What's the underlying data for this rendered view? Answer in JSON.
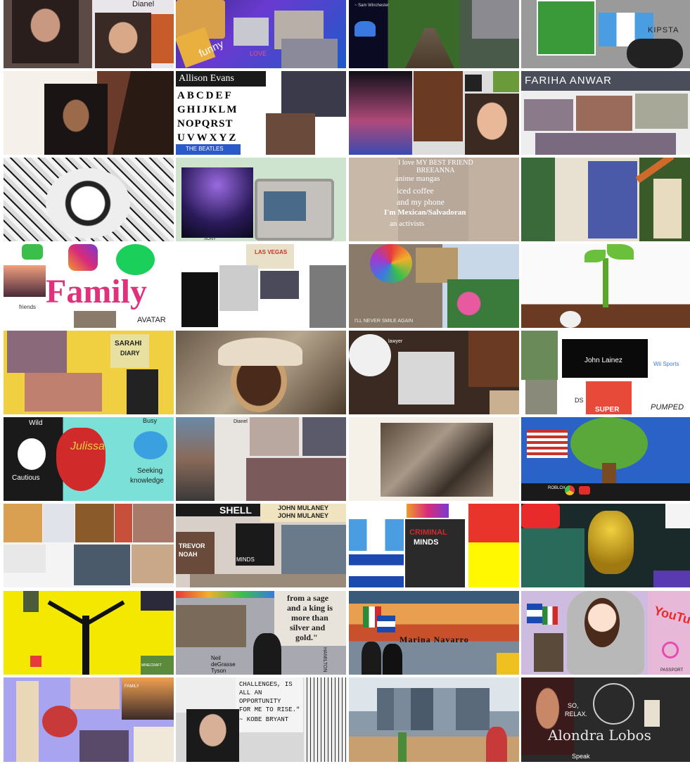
{
  "tiles": [
    {
      "id": "r0c0",
      "texts": {
        "name": "Dianel"
      }
    },
    {
      "id": "r0c1",
      "texts": {
        "a": "funny",
        "b": "LOVE"
      }
    },
    {
      "id": "r0c2",
      "texts": {
        "a": "~ Sam Winchester"
      }
    },
    {
      "id": "r0c3",
      "texts": {
        "a": "KIPSTA"
      }
    },
    {
      "id": "r1c0",
      "texts": {}
    },
    {
      "id": "r1c1",
      "texts": {
        "name": "Allison Evans",
        "alpha1": "ABCDEF",
        "alpha2": "GHIJKLM",
        "alpha3": "NOPQRST",
        "alpha4": "UVWXYZ",
        "band": "THE BEATLES"
      }
    },
    {
      "id": "r1c2",
      "texts": {}
    },
    {
      "id": "r1c3",
      "texts": {
        "name": "FARIHA ANWAR"
      }
    },
    {
      "id": "r2c0",
      "texts": {}
    },
    {
      "id": "r2c1",
      "texts": {
        "a": "SONY"
      }
    },
    {
      "id": "r2c2",
      "texts": {
        "l1": "I love MY BEST FRIEND",
        "l2": "BREEANNA",
        "l3": "anime mangas",
        "l4": "iced coffee",
        "l5": "and my phone",
        "l6": "I'm Mexican/Salvadoran",
        "l7": "an activists"
      }
    },
    {
      "id": "r2c3",
      "texts": {}
    },
    {
      "id": "r3c0",
      "texts": {
        "family": "Family",
        "friends": "friends",
        "avatar": "AVATAR"
      }
    },
    {
      "id": "r3c1",
      "texts": {
        "a": "LAS VEGAS"
      }
    },
    {
      "id": "r3c2",
      "texts": {
        "a": "I'LL NEVER SMILE AGAIN"
      }
    },
    {
      "id": "r3c3",
      "texts": {}
    },
    {
      "id": "r4c0",
      "texts": {
        "a": "SARAHI",
        "b": "DIARY"
      }
    },
    {
      "id": "r4c1",
      "texts": {}
    },
    {
      "id": "r4c2",
      "texts": {
        "a": "lawyer"
      }
    },
    {
      "id": "r4c3",
      "texts": {
        "name": "John Lainez",
        "wii": "Wii Sports",
        "ds": "DS",
        "pumped": "PUMPED",
        "super": "SUPER"
      }
    },
    {
      "id": "r5c0",
      "texts": {
        "wild": "Wild",
        "busy": "Busy",
        "name": "Julissa",
        "cautious": "Cautious",
        "seeking1": "Seeking",
        "seeking2": "knowledge"
      }
    },
    {
      "id": "r5c1",
      "texts": {
        "a": "Dianel"
      }
    },
    {
      "id": "r5c2",
      "texts": {}
    },
    {
      "id": "r5c3",
      "texts": {
        "a": "ROBLOX"
      }
    },
    {
      "id": "r6c0",
      "texts": {}
    },
    {
      "id": "r6c1",
      "texts": {
        "shell": "SHELL",
        "mulaney1": "JOHN MULANEY",
        "mulaney2": "JOHN MULANEY",
        "trevor1": "TREVOR",
        "trevor2": "NOAH",
        "minds": "MINDS"
      }
    },
    {
      "id": "r6c2",
      "texts": {
        "a": "CRIMINAL",
        "b": "MINDS"
      }
    },
    {
      "id": "r6c3",
      "texts": {}
    },
    {
      "id": "r7c0",
      "texts": {
        "mc": "MINECRAFT"
      }
    },
    {
      "id": "r7c1",
      "texts": {
        "q1": "from a sage",
        "q2": "and a king is",
        "q3": "more than",
        "q4": "silver and",
        "q5": "gold.\"",
        "ham": "HAMILTON",
        "ndg1": "Neil",
        "ndg2": "deGrasse",
        "ndg3": "Tyson"
      }
    },
    {
      "id": "r7c2",
      "texts": {
        "name": "Marina Navarro"
      }
    },
    {
      "id": "r7c3",
      "texts": {
        "yt": "YouTube",
        "pass": "PASSPORT"
      }
    },
    {
      "id": "r8c0",
      "texts": {
        "a": "FAMILY"
      }
    },
    {
      "id": "r8c1",
      "texts": {
        "q1": "CHALLENGES, IS",
        "q2": "ALL AN",
        "q3": "OPPORTUNITY",
        "q4": "FOR ME TO RISE.\"",
        "q5": "~ KOBE BRYANT"
      }
    },
    {
      "id": "r8c2",
      "texts": {}
    },
    {
      "id": "r8c3",
      "texts": {
        "a": "SO,",
        "b": "RELAX.",
        "name": "Alondra Lobos",
        "speak": "Speak"
      }
    }
  ]
}
